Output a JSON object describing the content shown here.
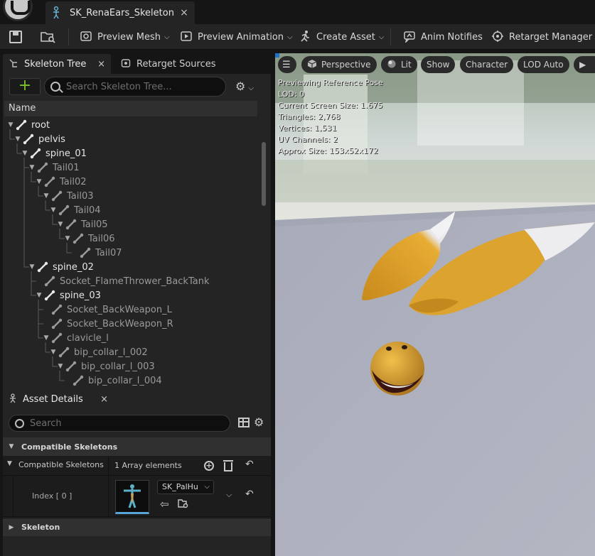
{
  "document_tab": {
    "title": "SK_RenaEars_Skeleton",
    "close": "×"
  },
  "toolbar": {
    "preview_mesh": "Preview Mesh",
    "preview_animation": "Preview Animation",
    "create_asset": "Create Asset",
    "anim_notifies": "Anim Notifies",
    "retarget_manager": "Retarget Manager"
  },
  "skeleton_tree": {
    "tab_label": "Skeleton Tree",
    "tab_close": "×",
    "other_tab_label": "Retarget Sources",
    "add_label": "+",
    "search_placeholder": "Search Skeleton Tree...",
    "column_header": "Name",
    "rows": [
      {
        "label": "root",
        "depth": 0,
        "expanded": true,
        "bone_style": "white"
      },
      {
        "label": "pelvis",
        "depth": 1,
        "expanded": true,
        "bone_style": "white"
      },
      {
        "label": "spine_01",
        "depth": 2,
        "expanded": true,
        "bone_style": "white"
      },
      {
        "label": "Tail01",
        "depth": 3,
        "expanded": true,
        "bone_style": "grey"
      },
      {
        "label": "Tail02",
        "depth": 4,
        "expanded": true,
        "bone_style": "grey"
      },
      {
        "label": "Tail03",
        "depth": 5,
        "expanded": true,
        "bone_style": "grey"
      },
      {
        "label": "Tail04",
        "depth": 6,
        "expanded": true,
        "bone_style": "grey"
      },
      {
        "label": "Tail05",
        "depth": 7,
        "expanded": true,
        "bone_style": "grey"
      },
      {
        "label": "Tail06",
        "depth": 8,
        "expanded": true,
        "bone_style": "grey"
      },
      {
        "label": "Tail07",
        "depth": 9,
        "expanded": false,
        "bone_style": "grey"
      },
      {
        "label": "spine_02",
        "depth": 3,
        "expanded": true,
        "bone_style": "white"
      },
      {
        "label": "Socket_FlameThrower_BackTank",
        "depth": 4,
        "expanded": false,
        "bone_style": "grey"
      },
      {
        "label": "spine_03",
        "depth": 4,
        "expanded": true,
        "bone_style": "white"
      },
      {
        "label": "Socket_BackWeapon_L",
        "depth": 5,
        "expanded": false,
        "bone_style": "grey"
      },
      {
        "label": "Socket_BackWeapon_R",
        "depth": 5,
        "expanded": false,
        "bone_style": "grey"
      },
      {
        "label": "clavicle_l",
        "depth": 5,
        "expanded": true,
        "bone_style": "grey"
      },
      {
        "label": "bip_collar_l_002",
        "depth": 6,
        "expanded": true,
        "bone_style": "grey"
      },
      {
        "label": "bip_collar_l_003",
        "depth": 7,
        "expanded": true,
        "bone_style": "grey"
      },
      {
        "label": "bip_collar_l_004",
        "depth": 8,
        "expanded": false,
        "bone_style": "grey"
      }
    ]
  },
  "asset_details": {
    "tab_label": "Asset Details",
    "tab_close": "×",
    "search_placeholder": "Search",
    "category_compatible": "Compatible Skeletons",
    "prop_compatible": "Compatible Skeletons",
    "array_elements": "1 Array elements",
    "index_label": "Index [ 0 ]",
    "asset_name": "SK_PalHu",
    "category_skeleton": "Skeleton"
  },
  "viewport": {
    "btn_perspective": "Perspective",
    "btn_lit": "Lit",
    "btn_show": "Show",
    "btn_character": "Character",
    "btn_lod": "LOD Auto",
    "stats": [
      "Previewing Reference Pose",
      "LOD: 0",
      "Current Screen Size: 1.675",
      "Triangles: 2,768",
      "Vertices: 1,531",
      "UV Channels: 2",
      "Approx Size: 153x52x172"
    ]
  },
  "colors": {
    "accent_green": "#7cc12e",
    "selection_blue": "#1e73c8",
    "ear_yellow": "#e3a52a"
  }
}
